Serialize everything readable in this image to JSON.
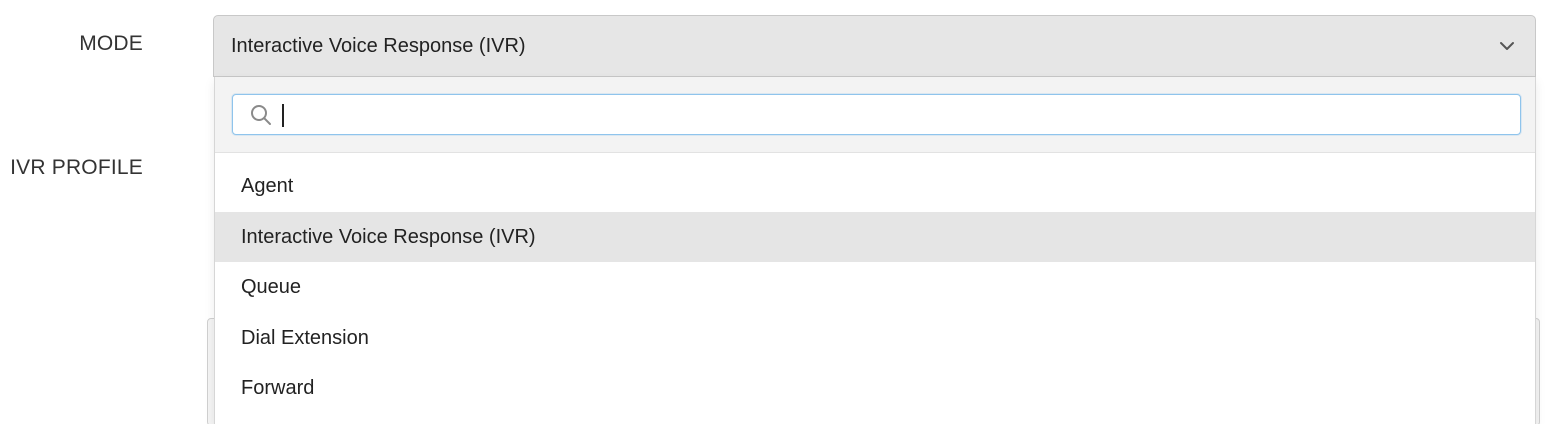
{
  "form": {
    "mode_label": "MODE",
    "ivr_profile_label": "IVR PROFILE"
  },
  "mode_select": {
    "value": "Interactive Voice Response (IVR)",
    "search_value": "",
    "options": [
      {
        "label": "Agent",
        "selected": false
      },
      {
        "label": "Interactive Voice Response (IVR)",
        "selected": true
      },
      {
        "label": "Queue",
        "selected": false
      },
      {
        "label": "Dial Extension",
        "selected": false
      },
      {
        "label": "Forward",
        "selected": false
      }
    ],
    "icons": {
      "toggle": "chevron-down-icon",
      "search": "search-icon"
    }
  },
  "colors": {
    "search_focus_border": "#8fc4ec",
    "selected_option_bg": "#e5e5e5",
    "select_bg": "#e6e6e6"
  }
}
